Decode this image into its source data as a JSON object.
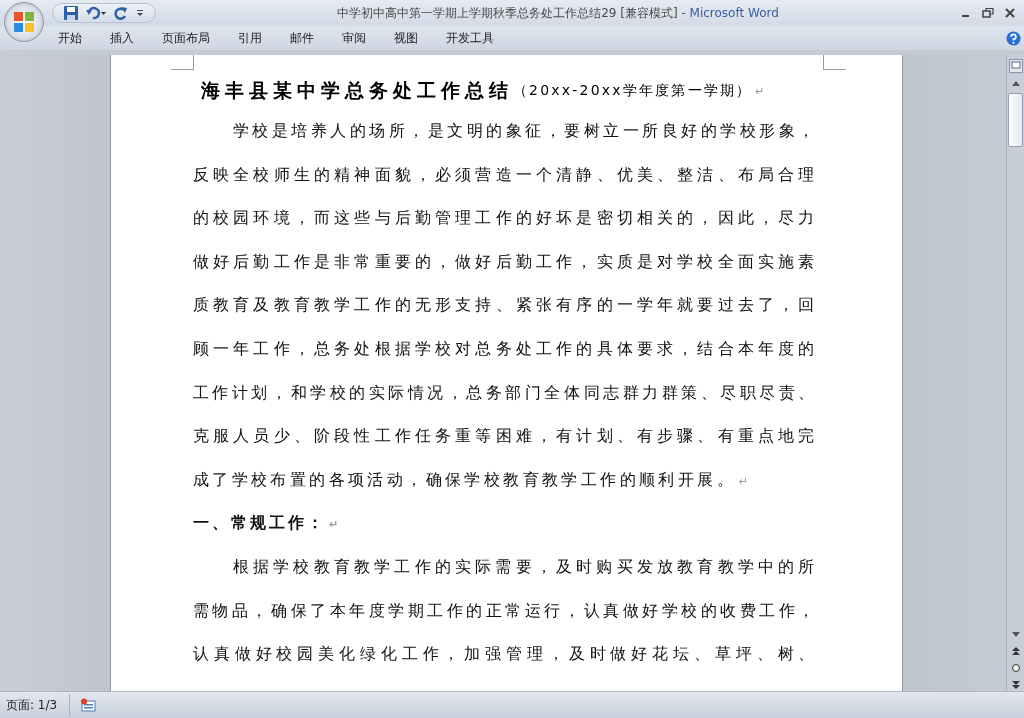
{
  "window": {
    "title": "中学初中高中第一学期上学期秋季总务处工作总结29 [兼容模式]",
    "app_name": "- Microsoft Word"
  },
  "ribbon_tabs": [
    {
      "label": "开始",
      "selected": false
    },
    {
      "label": "插入",
      "selected": false
    },
    {
      "label": "页面布局",
      "selected": false
    },
    {
      "label": "引用",
      "selected": false
    },
    {
      "label": "邮件",
      "selected": false
    },
    {
      "label": "审阅",
      "selected": false
    },
    {
      "label": "视图",
      "selected": false
    },
    {
      "label": "开发工具",
      "selected": false
    }
  ],
  "document": {
    "title": {
      "main": "海丰县某中学总务处工作总结",
      "sub": "（20xx-20xx学年度第一学期）",
      "mark": "↵"
    },
    "blocks": [
      {
        "kind": "paragraph",
        "lines": [
          "学校是培养人的场所，是文明的象征，要树立一所良好的学校形象，",
          "反映全校师生的精神面貌，必须营造一个清静、优美、整洁、布局合理",
          "的校园环境，而这些与后勤管理工作的好坏是密切相关的，因此，尽力",
          "做好后勤工作是非常重要的，做好后勤工作，实质是对学校全面实施素",
          "质教育及教育教学工作的无形支持、紧张有序的一学年就要过去了，回",
          "顾一年工作，总务处根据学校对总务处工作的具体要求，结合本年度的",
          "工作计划，和学校的实际情况，总务部门全体同志群力群策、尽职尽责、",
          "克服人员少、阶段性工作任务重等困难，有计划、有步骤、有重点地完",
          "成了学校布置的各项活动，确保学校教育教学工作的顺利开展。"
        ],
        "mark": "↵"
      },
      {
        "kind": "heading",
        "lines": [
          "一、常规工作："
        ],
        "mark": "↵"
      },
      {
        "kind": "paragraph",
        "lines": [
          "根据学校教育教学工作的实际需要，及时购买发放教育教学中的所",
          "需物品，确保了本年度学期工作的正常运行，认真做好学校的收费工作，",
          "认真做好校园美化绿化工作，加强管理，及时做好花坛、草坪、树、"
        ]
      }
    ]
  },
  "status_bar": {
    "page": "页面: 1/3"
  }
}
